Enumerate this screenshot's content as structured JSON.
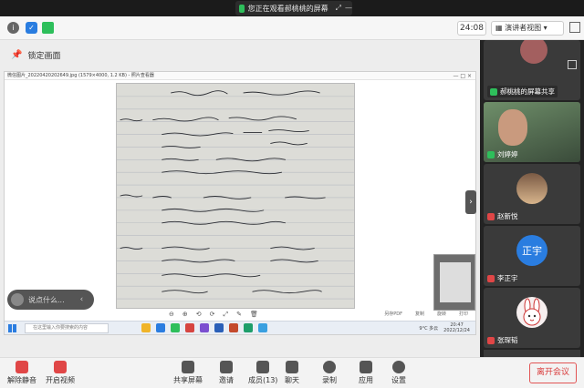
{
  "banner": {
    "text": "您正在观看郝桃桃的屏幕",
    "btn_a": "⤢",
    "btn_b": "—"
  },
  "infobar": {
    "time": "24:08",
    "view_button": "演讲者视图"
  },
  "stage": {
    "lock_label": "锁定画面",
    "chat_placeholder": "说点什么..."
  },
  "viewer": {
    "title": "微信图片_20220420202649.jpg (1579×4000, 1.2 KB) - 照片查看器",
    "controls": "— □ ×",
    "toolbar": [
      "⊖",
      "⊕",
      "⟲",
      "⟳",
      "⤢",
      "✎",
      "🗑"
    ],
    "right_labels": [
      "另存PDF",
      "复制",
      "旋转",
      "打印"
    ]
  },
  "taskbar": {
    "search_placeholder": "在这里输入你要搜索的内容",
    "tray": "9°C 多云",
    "clock_time": "20:47",
    "clock_date": "2022/12/24"
  },
  "participants": [
    {
      "name": "郝桃桃的屏幕共享",
      "mic": "on",
      "avatar": "photo-person"
    },
    {
      "name": "刘婷婷",
      "mic": "on",
      "avatar": "photo-woman"
    },
    {
      "name": "赵新悦",
      "mic": "off",
      "avatar": "photo-girl"
    },
    {
      "name": "李正宇",
      "mic": "off",
      "avatar_text": "正宇"
    },
    {
      "name": "张琛韬",
      "mic": "off",
      "avatar": "rabbit-icon"
    }
  ],
  "toolbar": {
    "unmute": "解除静音",
    "video": "开启视频",
    "share": "共享屏幕",
    "invite": "邀请",
    "members": "成员(13)",
    "chat": "聊天",
    "record": "录制",
    "apps": "应用",
    "settings": "设置",
    "end": "离开会议"
  },
  "colors": {
    "green": "#2ebf5b",
    "red": "#e04646",
    "blue": "#2a7de0"
  }
}
